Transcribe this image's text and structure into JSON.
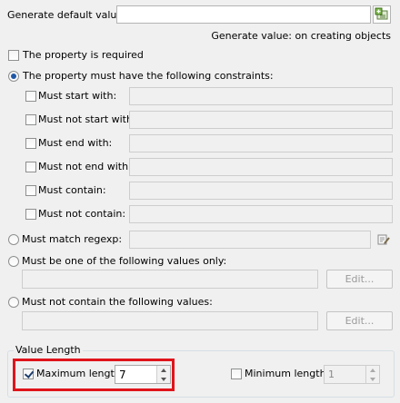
{
  "generate_default": {
    "label": "Generate default value:",
    "value": "",
    "button_icon": "add-expression-icon",
    "hint": "Generate value: on creating objects"
  },
  "required": {
    "label": "The property is required",
    "checked": false
  },
  "constraints": {
    "label": "The property must have the following constraints:",
    "selected": true,
    "items": [
      {
        "label": "Must start with:",
        "value": ""
      },
      {
        "label": "Must not start with:",
        "value": ""
      },
      {
        "label": "Must end with:",
        "value": ""
      },
      {
        "label": "Must not end with:",
        "value": ""
      },
      {
        "label": "Must contain:",
        "value": ""
      },
      {
        "label": "Must not contain:",
        "value": ""
      }
    ]
  },
  "regexp": {
    "label": "Must match regexp:",
    "value": "",
    "icon": "regex-editor-icon"
  },
  "values_only": {
    "label": "Must be one of the following values only:",
    "value": "",
    "edit_label": "Edit..."
  },
  "not_contain_values": {
    "label": "Must not contain the following values:",
    "value": "",
    "edit_label": "Edit..."
  },
  "value_length": {
    "title": "Value Length",
    "max": {
      "label": "Maximum length:",
      "checked": true,
      "value": "7"
    },
    "min": {
      "label": "Minimum length:",
      "checked": false,
      "value": "1"
    }
  },
  "highlight_color": "#e0141b"
}
